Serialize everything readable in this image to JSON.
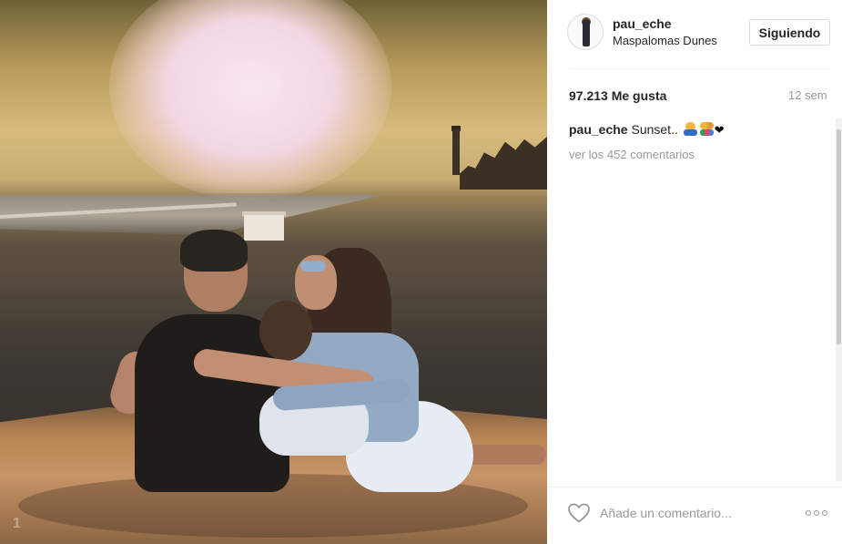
{
  "post": {
    "photo_index": "1",
    "author": {
      "username": "pau_eche",
      "location": "Maspalomas Dunes",
      "avatar_icon": "avatar-icon"
    },
    "follow_button_label": "Siguiendo",
    "likes_text": "97.213 Me gusta",
    "age_text": "12 sem",
    "caption": {
      "username": "pau_eche",
      "text": "Sunset..",
      "emojis": [
        "person-bowing-emoji",
        "family-emoji",
        "black-heart-emoji"
      ],
      "heart_glyph": "❤"
    },
    "view_comments_label": "ver los 452 comentarios",
    "comment_placeholder": "Añade un comentario...",
    "like_icon": "heart-icon",
    "more_icon": "more-options-icon"
  },
  "colors": {
    "text": "#262626",
    "muted": "#999999",
    "border": "#dbdbdb"
  }
}
